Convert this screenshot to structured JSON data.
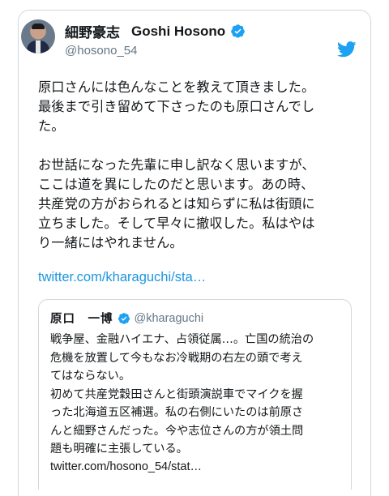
{
  "author": {
    "display_name_jp": "細野豪志",
    "display_name_en": "Goshi Hosono",
    "handle": "@hosono_54"
  },
  "tweet": {
    "paragraph1": "原口さんには色んなことを教えて頂きました。\n最後まで引き留めて下さったのも原口さんでし\nた。",
    "paragraph2": "お世話になった先輩に申し訳なく思いますが、\nここは道を異にしたのだと思います。あの時、\n共産党の方がおられるとは知らずに私は街頭に\n立ちました。そして早々に撤収した。私はやは\nり一緒にはやれません。",
    "link": "twitter.com/kharaguchi/sta…"
  },
  "quoted_tweet": {
    "name": "原口　一博",
    "handle": "@kharaguchi",
    "text": "戦争屋、金融ハイエナ、占領従属…。亡国の統治の\n危機を放置して今もなお冷戦期の右左の頭で考え\nてはならない。\n初めて共産党穀田さんと街頭演説車でマイクを握\nった北海道五区補選。私の右側にいたのは前原さ\nんと細野さんだった。今や志位さんの方が領土問\n題も明確に主張している。",
    "link": "twitter.com/hosono_54/stat…"
  },
  "colors": {
    "accent": "#1da1f2",
    "link": "#1b95e0",
    "secondary_text": "#657786",
    "border": "#cfd9de"
  },
  "icons": {
    "verified": "verified-badge-icon",
    "brand": "twitter-bird-icon"
  }
}
